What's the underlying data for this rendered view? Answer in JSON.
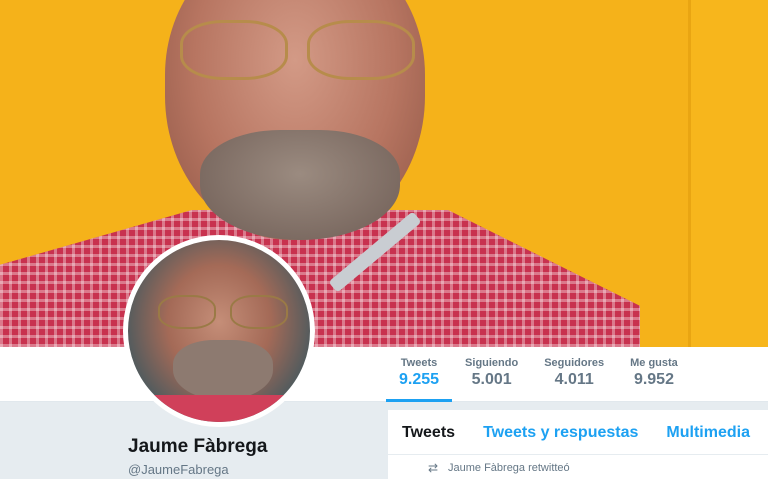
{
  "header": {
    "banner_colors": {
      "background": "#f5b21a",
      "accent": "#1da1f2"
    }
  },
  "stats": [
    {
      "label": "Tweets",
      "value": "9.255",
      "active": true
    },
    {
      "label": "Siguiendo",
      "value": "5.001"
    },
    {
      "label": "Seguidores",
      "value": "4.011"
    },
    {
      "label": "Me gusta",
      "value": "9.952"
    }
  ],
  "profile": {
    "name": "Jaume Fàbrega",
    "handle": "@JaumeFabrega"
  },
  "timeline": {
    "tabs": [
      "Tweets",
      "Tweets y respuestas",
      "Multimedia"
    ],
    "retweet_label": "Jaume Fàbrega retwitteó",
    "retweet_icon": "retweet-icon"
  }
}
